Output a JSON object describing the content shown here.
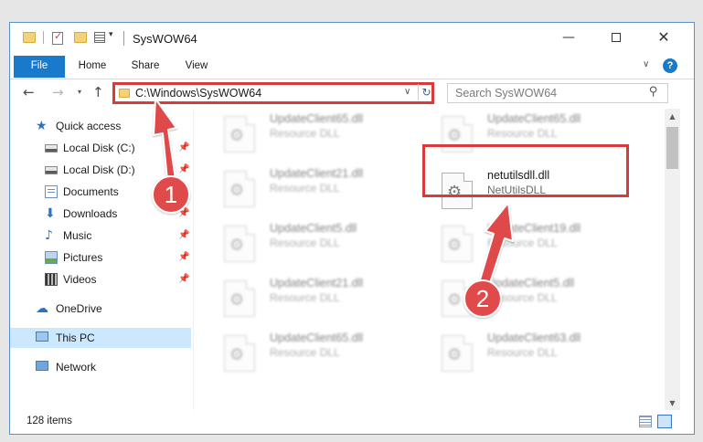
{
  "window": {
    "title": "SysWOW64",
    "controls": {
      "minimize": "—",
      "maximize": "",
      "close": "✕"
    }
  },
  "ribbon": {
    "tabs": [
      "File",
      "Home",
      "Share",
      "View"
    ]
  },
  "address_bar": {
    "path": "C:\\Windows\\SysWOW64"
  },
  "search": {
    "placeholder": "Search SysWOW64"
  },
  "sidebar": {
    "items": [
      {
        "label": "Quick access",
        "icon": "star-icon",
        "pinned": false
      },
      {
        "label": "Local Disk (C:)",
        "icon": "disk-icon",
        "pinned": true
      },
      {
        "label": "Local Disk (D:)",
        "icon": "disk-icon",
        "pinned": true
      },
      {
        "label": "Documents",
        "icon": "documents-icon",
        "pinned": true
      },
      {
        "label": "Downloads",
        "icon": "download-icon",
        "pinned": true
      },
      {
        "label": "Music",
        "icon": "music-icon",
        "pinned": true
      },
      {
        "label": "Pictures",
        "icon": "pictures-icon",
        "pinned": true
      },
      {
        "label": "Videos",
        "icon": "videos-icon",
        "pinned": true
      },
      {
        "label": "OneDrive",
        "icon": "cloud-icon",
        "pinned": false
      },
      {
        "label": "This PC",
        "icon": "pc-icon",
        "pinned": false,
        "selected": true
      },
      {
        "label": "Network",
        "icon": "network-icon",
        "pinned": false
      }
    ]
  },
  "files": {
    "left_column": [
      {
        "name": "UpdateClient65.dll",
        "type": "Resource DLL"
      },
      {
        "name": "UpdateClient21.dll",
        "type": "Resource DLL"
      },
      {
        "name": "UpdateClient5.dll",
        "type": "Resource DLL"
      },
      {
        "name": "UpdateClient21.dll",
        "type": "Resource DLL"
      },
      {
        "name": "UpdateClient65.dll",
        "type": "Resource DLL"
      }
    ],
    "right_column": [
      {
        "name": "UpdateClient65.dll",
        "type": "Resource DLL"
      },
      {
        "name": "netutilsdll.dll",
        "type": "NetUtilsDLL",
        "highlighted": true
      },
      {
        "name": "UpdateClient19.dll",
        "type": "Resource DLL"
      },
      {
        "name": "UpdateClient5.dll",
        "type": "Resource DLL"
      },
      {
        "name": "UpdateClient63.dll",
        "type": "Resource DLL"
      }
    ]
  },
  "status_bar": {
    "item_count": "128 items"
  },
  "annotations": {
    "step1": "1",
    "step2": "2",
    "color": "#e04a4a"
  }
}
